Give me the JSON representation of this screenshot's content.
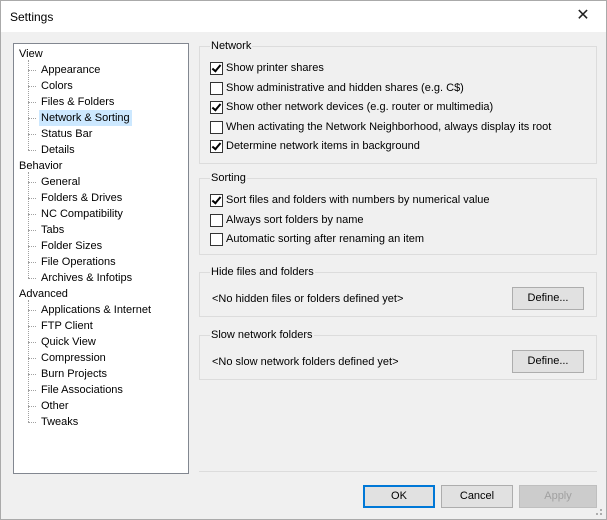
{
  "window": {
    "title": "Settings",
    "close_glyph": "✕"
  },
  "tree": {
    "groups": [
      {
        "label": "View",
        "children": [
          "Appearance",
          "Colors",
          "Files & Folders",
          "Network & Sorting",
          "Status Bar",
          "Details"
        ]
      },
      {
        "label": "Behavior",
        "children": [
          "General",
          "Folders & Drives",
          "NC Compatibility",
          "Tabs",
          "Folder Sizes",
          "File Operations",
          "Archives & Infotips"
        ]
      },
      {
        "label": "Advanced",
        "children": [
          "Applications & Internet",
          "FTP Client",
          "Quick View",
          "Compression",
          "Burn Projects",
          "File Associations",
          "Other",
          "Tweaks"
        ]
      }
    ],
    "selected": "Network & Sorting"
  },
  "network": {
    "title": "Network",
    "options": [
      {
        "label": "Show printer shares",
        "checked": true
      },
      {
        "label": "Show administrative and hidden shares (e.g. C$)",
        "checked": false
      },
      {
        "label": "Show other network devices (e.g. router or multimedia)",
        "checked": true
      },
      {
        "label": "When activating the Network Neighborhood, always display its root",
        "checked": false
      },
      {
        "label": "Determine network items in background",
        "checked": true
      }
    ]
  },
  "sorting": {
    "title": "Sorting",
    "options": [
      {
        "label": "Sort files and folders with numbers by numerical value",
        "checked": true
      },
      {
        "label": "Always sort folders by name",
        "checked": false
      },
      {
        "label": "Automatic sorting after renaming an item",
        "checked": false
      }
    ]
  },
  "hide_files": {
    "title": "Hide files and folders",
    "text": "<No hidden files or folders defined yet>",
    "button": "Define..."
  },
  "slow_network": {
    "title": "Slow network folders",
    "text": "<No slow network folders defined yet>",
    "button": "Define..."
  },
  "footer": {
    "ok": "OK",
    "cancel": "Cancel",
    "apply": "Apply"
  }
}
